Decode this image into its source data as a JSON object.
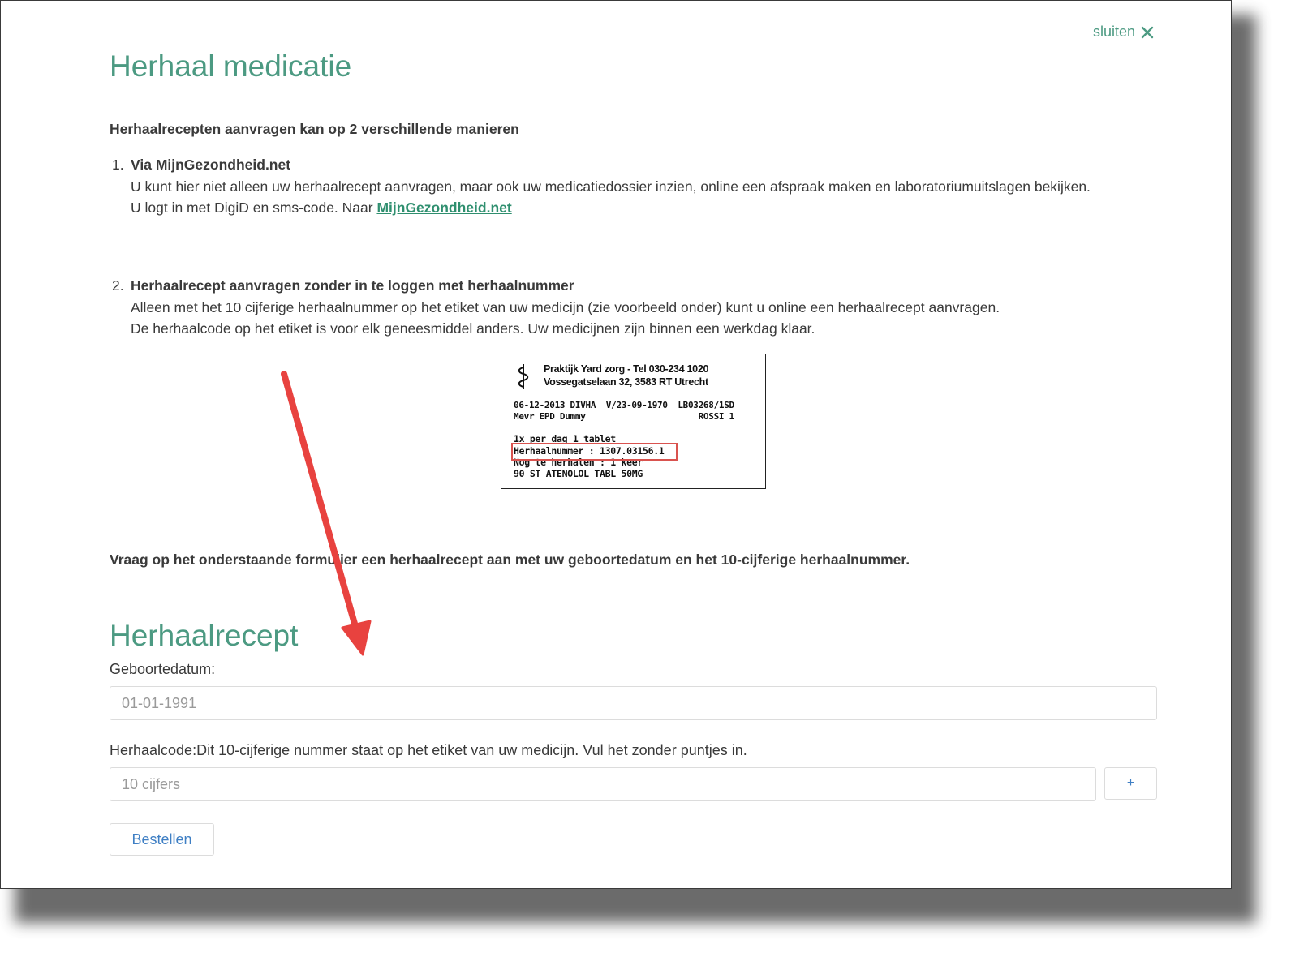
{
  "dialog": {
    "close_label": "sluiten",
    "title": "Herhaal medicatie",
    "intro": "Herhaalrecepten aanvragen kan op 2 verschillende manieren"
  },
  "options": [
    {
      "number": "1.",
      "heading": "Via MijnGezondheid.net",
      "text": "U kunt hier niet alleen uw herhaalrecept aanvragen, maar ook uw medicatiedossier inzien, online een afspraak maken en laboratoriumuitslagen bekijken. U logt in met DigiD en sms-code. Naar",
      "link": "MijnGezondheid.net"
    },
    {
      "number": "2.",
      "heading": "Herhaalrecept aanvragen zonder in te loggen met herhaalnummer",
      "line1": "Alleen met het 10 cijferige herhaalnummer op het etiket van uw medicijn (zie voorbeeld onder) kunt u online een herhaalrecept aanvragen.",
      "line2": "De herhaalcode op het etiket is voor elk geneesmiddel anders. Uw medicijnen zijn binnen een werkdag klaar."
    }
  ],
  "label_example": {
    "line1": "Praktijk Yard zorg - Tel 030-234 1020",
    "line2": "Vossegatselaan 32, 3583 RT Utrecht",
    "line3": "06-12-2013 DIVHA  V/23-09-1970  LB03268/1SD",
    "line4": "Mevr EPD Dummy                      ROSSI 1",
    "line5": "1x per dag 1 tablet",
    "line6": "Herhaalnummer : 1307.03156.1",
    "line7": "Nog te herhalen : 1 keer",
    "line8": "90 ST ATENOLOL TABL 50MG"
  },
  "form": {
    "intro": "Vraag op het onderstaande formulier een herhaalrecept aan met uw geboortedatum en het 10-cijferige herhaalnummer.",
    "title": "Herhaalrecept",
    "birth_label": "Geboortedatum:",
    "birth_placeholder": "01-01-1991",
    "code_label": "Herhaalcode:Dit 10-cijferige nummer staat op het etiket van uw medicijn. Vul het zonder puntjes in.",
    "code_placeholder": "10 cijfers",
    "add_label": "+",
    "submit_label": "Bestellen"
  },
  "colors": {
    "accent": "#4c9a82",
    "link": "#2f8f6f",
    "button_text": "#3f7fc4",
    "annotation_arrow": "#e8423f",
    "highlight_box": "#d9534f"
  },
  "icons": {
    "close": "close-icon",
    "logo": "caduceus-icon"
  }
}
